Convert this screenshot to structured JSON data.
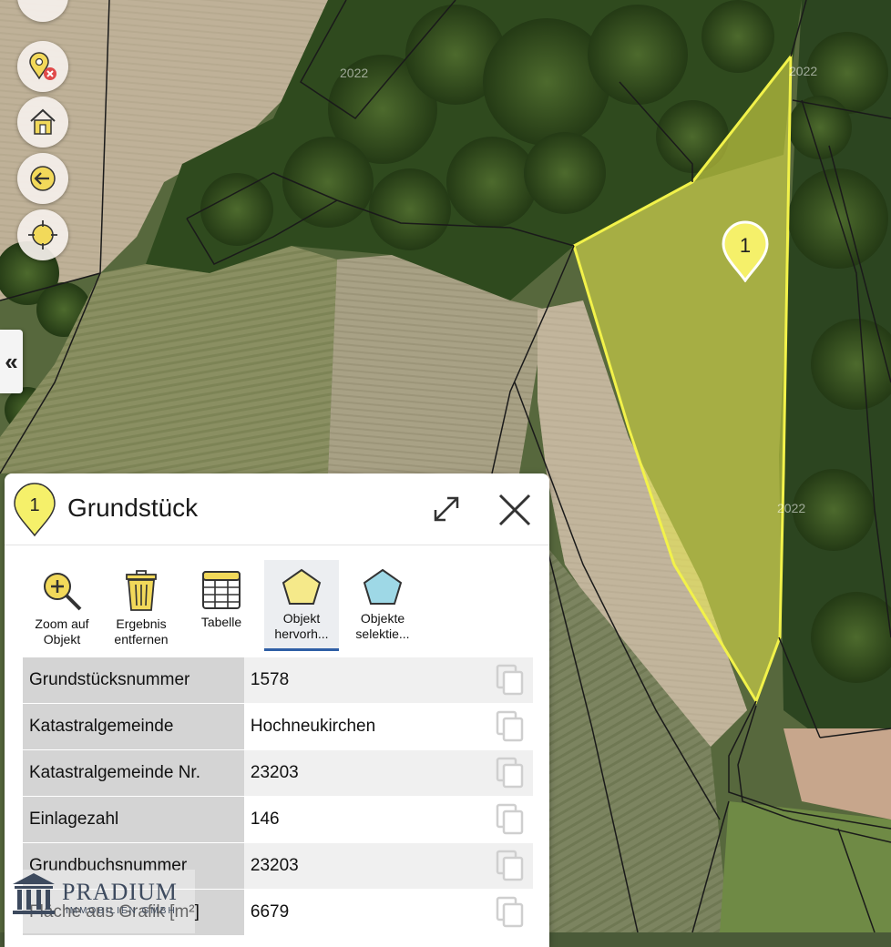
{
  "map": {
    "year_labels": [
      "2022",
      "2022",
      "2022"
    ],
    "parcel_marker_label": "1",
    "colors": {
      "parcel_fill": "#e8e84a",
      "parcel_stroke": "#f2f24a",
      "boundary": "#1a1a1a"
    }
  },
  "map_controls": {
    "items": [
      {
        "name": "top-control",
        "icon": "circle-icon"
      },
      {
        "name": "remove-marker",
        "icon": "marker-remove-icon"
      },
      {
        "name": "home",
        "icon": "home-icon"
      },
      {
        "name": "back",
        "icon": "arrow-left-icon"
      },
      {
        "name": "locate",
        "icon": "crosshair-icon"
      }
    ],
    "collapse_label": "«"
  },
  "panel": {
    "pin_label": "1",
    "title": "Grundstück",
    "expand_icon": "expand-icon",
    "close_icon": "close-icon",
    "toolbar": {
      "zoom_label_1": "Zoom auf",
      "zoom_label_2": "Objekt",
      "remove_label_1": "Ergebnis",
      "remove_label_2": "entfernen",
      "table_label": "Tabelle",
      "highlight_label_1": "Objekt",
      "highlight_label_2": "hervorh...",
      "select_label_1": "Objekte",
      "select_label_2": "selektie..."
    },
    "attributes": [
      {
        "key": "Grundstücksnummer",
        "value": "1578"
      },
      {
        "key": "Katastralgemeinde",
        "value": "Hochneukirchen"
      },
      {
        "key": "Katastralgemeinde Nr.",
        "value": "23203"
      },
      {
        "key": "Einlagezahl",
        "value": "146"
      },
      {
        "key": "Grundbuchsnummer",
        "value": "23203"
      },
      {
        "key": "Fläche aus Grafik [m²]",
        "value": "6679"
      }
    ]
  },
  "watermark": {
    "name": "PRADIUM",
    "subtitle": "IMMOBILIEN GMBH"
  }
}
